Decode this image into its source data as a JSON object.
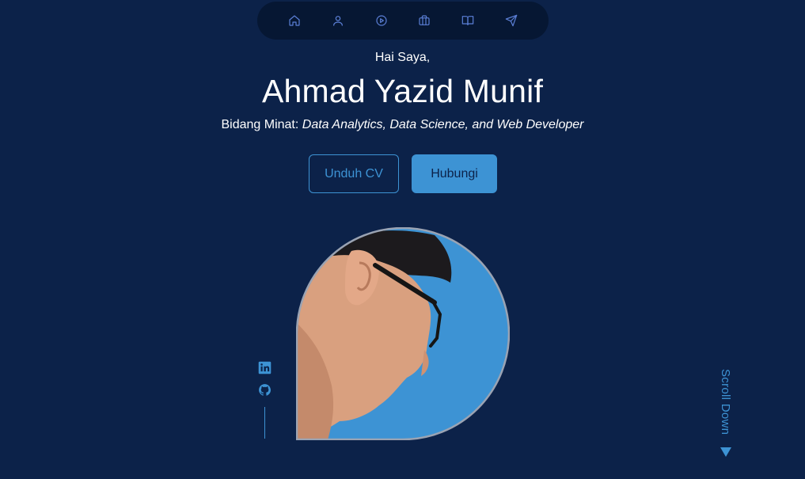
{
  "nav": {
    "items": [
      {
        "icon": "home-icon"
      },
      {
        "icon": "user-icon"
      },
      {
        "icon": "play-circle-icon"
      },
      {
        "icon": "briefcase-icon"
      },
      {
        "icon": "book-open-icon"
      },
      {
        "icon": "send-icon"
      }
    ]
  },
  "hero": {
    "greeting": "Hai Saya,",
    "name": "Ahmad Yazid Munif",
    "interest_label": "Bidang Minat: ",
    "interest_value": "Data Analytics, Data Science, and Web Developer"
  },
  "buttons": {
    "download_cv": "Unduh CV",
    "contact": "Hubungi"
  },
  "socials": [
    {
      "icon": "linkedin-icon"
    },
    {
      "icon": "github-icon"
    }
  ],
  "scroll": {
    "label": "Scroll Down"
  },
  "colors": {
    "background": "#0c2249",
    "nav_background": "#061733",
    "accent": "#3d93d4",
    "nav_icon": "#5b7fd6",
    "text": "#ffffff"
  }
}
